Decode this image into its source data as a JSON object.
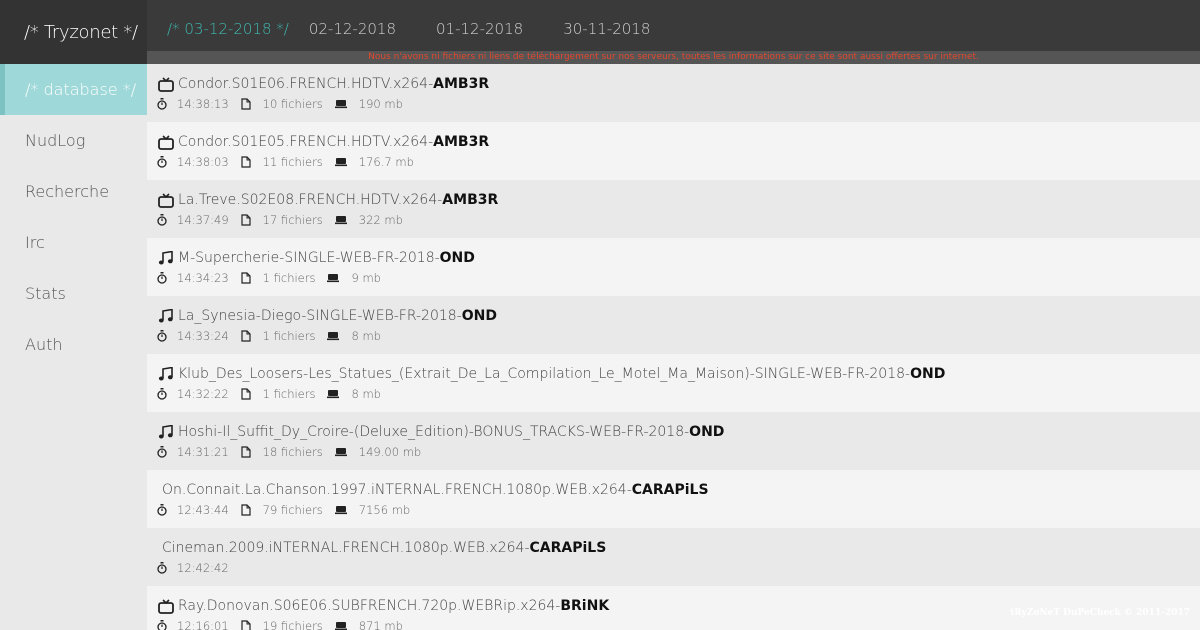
{
  "brand": "/* Tryzonet */",
  "nav": [
    {
      "label": "/* database */",
      "active": true
    },
    {
      "label": "NudLog"
    },
    {
      "label": "Recherche"
    },
    {
      "label": "Irc"
    },
    {
      "label": "Stats"
    },
    {
      "label": "Auth"
    }
  ],
  "tabs": [
    {
      "label": "/* 03-12-2018 */",
      "active": true
    },
    {
      "label": "02-12-2018"
    },
    {
      "label": "01-12-2018"
    },
    {
      "label": "30-11-2018"
    }
  ],
  "notice": "Nous n'avons ni fichiers ni liens de téléchargement sur nos serveurs, toutes les informations sur ce site sont aussi offertes sur internet.",
  "releases": [
    {
      "icon": "tv",
      "name": "Condor.S01E06.FRENCH.HDTV.x264-",
      "group": "AMB3R",
      "time": "14:38:13",
      "files": "10 fichiers",
      "size": "190 mb"
    },
    {
      "icon": "tv",
      "name": "Condor.S01E05.FRENCH.HDTV.x264-",
      "group": "AMB3R",
      "time": "14:38:03",
      "files": "11 fichiers",
      "size": "176.7 mb"
    },
    {
      "icon": "tv",
      "name": "La.Treve.S02E08.FRENCH.HDTV.x264-",
      "group": "AMB3R",
      "time": "14:37:49",
      "files": "17 fichiers",
      "size": "322 mb"
    },
    {
      "icon": "music",
      "name": "M-Supercherie-SINGLE-WEB-FR-2018-",
      "group": "OND",
      "time": "14:34:23",
      "files": "1 fichiers",
      "size": "9 mb"
    },
    {
      "icon": "music",
      "name": "La_Synesia-Diego-SINGLE-WEB-FR-2018-",
      "group": "OND",
      "time": "14:33:24",
      "files": "1 fichiers",
      "size": "8 mb"
    },
    {
      "icon": "music",
      "name": "Klub_Des_Loosers-Les_Statues_(Extrait_De_La_Compilation_Le_Motel_Ma_Maison)-SINGLE-WEB-FR-2018-",
      "group": "OND",
      "time": "14:32:22",
      "files": "1 fichiers",
      "size": "8 mb"
    },
    {
      "icon": "music",
      "name": "Hoshi-Il_Suffit_Dy_Croire-(Deluxe_Edition)-BONUS_TRACKS-WEB-FR-2018-",
      "group": "OND",
      "time": "14:31:21",
      "files": "18 fichiers",
      "size": "149.00 mb"
    },
    {
      "icon": "",
      "name": "On.Connait.La.Chanson.1997.iNTERNAL.FRENCH.1080p.WEB.x264-",
      "group": "CARAPiLS",
      "time": "12:43:44",
      "files": "79 fichiers",
      "size": "7156 mb"
    },
    {
      "icon": "",
      "name": "Cineman.2009.iNTERNAL.FRENCH.1080p.WEB.x264-",
      "group": "CARAPiLS",
      "time": "12:42:42",
      "files": "",
      "size": ""
    },
    {
      "icon": "tv",
      "name": "Ray.Donovan.S06E06.SUBFRENCH.720p.WEBRip.x264-",
      "group": "BRiNK",
      "time": "12:16:01",
      "files": "19 fichiers",
      "size": "871 mb"
    }
  ],
  "footer": "tRyZoNeT DuPeCheck © 2011-2017"
}
